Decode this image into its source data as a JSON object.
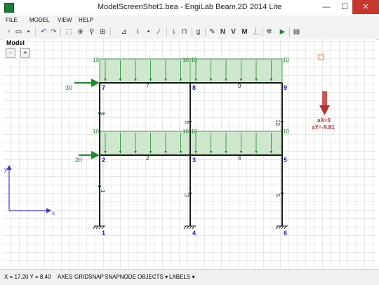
{
  "window": {
    "title": "ModelScreenShot1.bea - EngiLab Beam.2D 2014 Lite",
    "minimize_glyph": "—",
    "maximize_glyph": "☐",
    "close_glyph": "✕"
  },
  "menu": [
    "FILE",
    "MODEL",
    "VIEW",
    "HELP"
  ],
  "toolbar": {
    "icons": [
      "new-file-icon",
      "open-file-icon",
      "save-icon",
      "undo-icon",
      "redo-icon",
      "select-icon",
      "zoom-extents-icon",
      "zoom-icon",
      "zoom-window-icon",
      "measure-icon",
      "dimension-icon",
      "node-icon",
      "element-icon",
      "support-icon",
      "hinge-icon",
      "gravity-icon",
      "pencil-icon",
      "shear-diagram-icon",
      "axial-diagram-icon",
      "moment-diagram-icon",
      "deformed-icon",
      "settings-icon",
      "run-icon",
      "report-icon"
    ],
    "glyphs": {
      "gravity": "g",
      "shear": "N",
      "axial": "V",
      "moment": "M"
    }
  },
  "panel": {
    "title": "Model",
    "zoom_out": "-",
    "zoom_in": "+"
  },
  "model": {
    "udl_labels": [
      "10",
      "10",
      "10",
      "10",
      "10",
      "10",
      "10",
      "10"
    ],
    "nodal_loads": [
      "30",
      "20"
    ],
    "node_labels": [
      "1",
      "2",
      "3",
      "4",
      "5",
      "6",
      "7",
      "8",
      "9"
    ],
    "element_labels": [
      "1",
      "2",
      "3",
      "4",
      "5",
      "6",
      "7",
      "8",
      "9",
      "10"
    ],
    "acceleration": {
      "ax": "aX=0",
      "ay": "aY=-9.81"
    },
    "axis": {
      "x": "x",
      "y": "y"
    },
    "colors": {
      "load": "#1e8a2f",
      "load_fill": "#cfe8cd",
      "member": "#1a1a1a",
      "node_label": "#1a1acd",
      "accel": "#b33030",
      "axis": "#3b3bdc"
    }
  },
  "status": {
    "coords": "X = 17.20  Y = 8.40",
    "items": [
      "AXES",
      "GRID",
      "SNAP",
      "SNAPNODE",
      "OBJECTS ▾",
      "LABELS ▾"
    ]
  }
}
